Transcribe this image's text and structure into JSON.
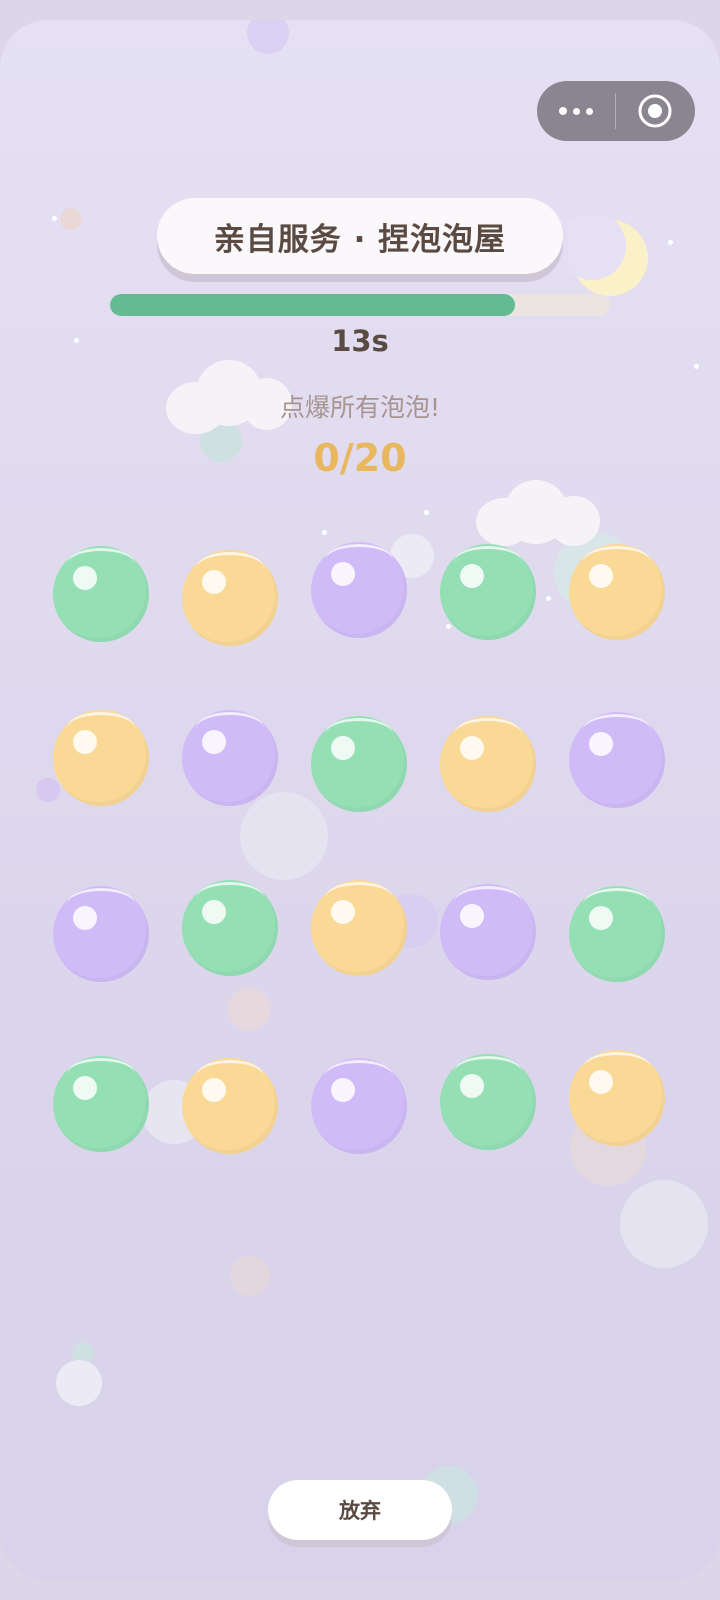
{
  "capsule": {
    "more_icon": "more-dots-icon",
    "close_icon": "target-circle-icon"
  },
  "game": {
    "title": "亲自服务 · 捏泡泡屋",
    "progress": 0.81,
    "timer": "13s",
    "hint": "点爆所有泡泡!",
    "count": "0/20"
  },
  "colors": {
    "green": "#95dfb5",
    "yellow": "#fad896",
    "purple": "#d0bbf8",
    "progress": "#63bb92",
    "accent": "#e9b75e"
  },
  "bubbles": [
    [
      "green",
      "yellow",
      "purple",
      "green",
      "yellow"
    ],
    [
      "yellow",
      "purple",
      "green",
      "yellow",
      "purple"
    ],
    [
      "purple",
      "green",
      "yellow",
      "purple",
      "green"
    ],
    [
      "green",
      "yellow",
      "purple",
      "green",
      "yellow"
    ]
  ],
  "footer": {
    "quit_label": "放弃"
  }
}
